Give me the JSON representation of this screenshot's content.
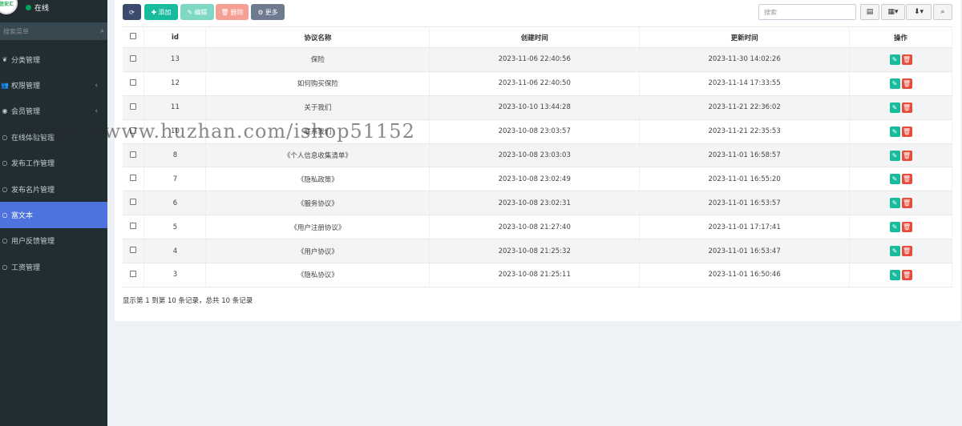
{
  "sidebar": {
    "avatar_text": "信安汇",
    "status": "在线",
    "search_placeholder": "搜索菜单",
    "items": [
      {
        "label": "分类管理",
        "icon": "leaf-icon",
        "chevron": false,
        "active": false
      },
      {
        "label": "权限管理",
        "icon": "users-icon",
        "chevron": true,
        "active": false
      },
      {
        "label": "会员管理",
        "icon": "user-circle-icon",
        "chevron": true,
        "active": false
      },
      {
        "label": "在线体验管理",
        "icon": "circle-icon",
        "chevron": false,
        "active": false
      },
      {
        "label": "发布工作管理",
        "icon": "circle-icon",
        "chevron": false,
        "active": false
      },
      {
        "label": "发布名片管理",
        "icon": "circle-icon",
        "chevron": false,
        "active": false
      },
      {
        "label": "富文本",
        "icon": "circle-icon",
        "chevron": false,
        "active": true
      },
      {
        "label": "用户反馈管理",
        "icon": "circle-icon",
        "chevron": false,
        "active": false
      },
      {
        "label": "工资管理",
        "icon": "circle-icon",
        "chevron": false,
        "active": false
      }
    ]
  },
  "toolbar": {
    "refresh_icon": "⟳",
    "add_label": "添加",
    "edit_label": "编辑",
    "delete_label": "删除",
    "more_label": "更多",
    "search_placeholder": "搜索"
  },
  "table": {
    "headers": {
      "id": "id",
      "name": "协议名称",
      "created": "创建时间",
      "updated": "更新时间",
      "actions": "操作"
    },
    "rows": [
      {
        "id": "13",
        "name": "保险",
        "created": "2023-11-06 22:40:56",
        "updated": "2023-11-30 14:02:26"
      },
      {
        "id": "12",
        "name": "如何购买保险",
        "created": "2023-11-06 22:40:50",
        "updated": "2023-11-14 17:33:55"
      },
      {
        "id": "11",
        "name": "关于我们",
        "created": "2023-10-10 13:44:28",
        "updated": "2023-11-21 22:36:02"
      },
      {
        "id": "10",
        "name": "联系我们",
        "created": "2023-10-08 23:03:57",
        "updated": "2023-11-21 22:35:53"
      },
      {
        "id": "8",
        "name": "《个人信息收集清单》",
        "created": "2023-10-08 23:03:03",
        "updated": "2023-11-01 16:58:57"
      },
      {
        "id": "7",
        "name": "《隐私政策》",
        "created": "2023-10-08 23:02:49",
        "updated": "2023-11-01 16:55:20"
      },
      {
        "id": "6",
        "name": "《服务协议》",
        "created": "2023-10-08 23:02:31",
        "updated": "2023-11-01 16:53:57"
      },
      {
        "id": "5",
        "name": "《用户注册协议》",
        "created": "2023-10-08 21:27:40",
        "updated": "2023-11-01 17:17:41"
      },
      {
        "id": "4",
        "name": "《用户协议》",
        "created": "2023-10-08 21:25:32",
        "updated": "2023-11-01 16:53:47"
      },
      {
        "id": "3",
        "name": "《隐私协议》",
        "created": "2023-10-08 21:25:11",
        "updated": "2023-11-01 16:50:46"
      }
    ]
  },
  "pagination": {
    "summary": "显示第 1 到第 10 条记录，总共 10 条记录"
  },
  "watermark": "https://www.huzhan.com/ishop51152",
  "colors": {
    "sidebar_bg": "#222d32",
    "active_item": "#4e73df",
    "add_button": "#18bc9c",
    "delete_button": "#e74c3c"
  }
}
